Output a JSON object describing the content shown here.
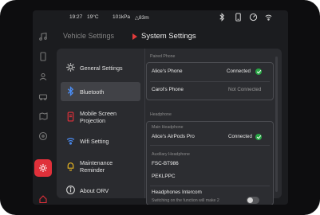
{
  "status": {
    "time": "19:27",
    "temp": "19°C",
    "pressure": "101kPa",
    "altitude": "△83m"
  },
  "status_icons": [
    "bluetooth-icon",
    "phone-icon",
    "speedometer-icon",
    "wifi-icon"
  ],
  "rail_icons": [
    "music-icon",
    "phone-icon",
    "profile-icon",
    "car-icon",
    "map-icon",
    "steering-icon",
    "settings-icon",
    "home-icon"
  ],
  "header": {
    "left": "Vehicle Settings",
    "right": "System Settings"
  },
  "menu": [
    {
      "label": "General Settings",
      "icon": "gear-icon"
    },
    {
      "label": "Bluetooth",
      "icon": "bluetooth-icon"
    },
    {
      "label_line1": "Mobile Screen",
      "label_line2": "Projection",
      "icon": "screen-projection-icon"
    },
    {
      "label": "Wifi Setting",
      "icon": "wifi-icon"
    },
    {
      "label_line1": "Maintenance",
      "label_line2": "Reminder",
      "icon": "bell-icon"
    },
    {
      "label": "About ORV",
      "icon": "info-icon"
    }
  ],
  "paired": {
    "title": "Paired Phone",
    "devices": [
      {
        "name": "Alice's Phone",
        "status": "Connected"
      },
      {
        "name": "Carol's Phone",
        "status": "Not Connected"
      }
    ]
  },
  "headphone": {
    "title": "Headphone",
    "main_label": "Main Headphone",
    "main": {
      "name": "Alice's AirPods Pro",
      "status": "Connected"
    },
    "aux_label": "Auxiliary Headphone",
    "aux": [
      "FSC-BT986",
      "PEKLPPC"
    ],
    "intercom_title": "Headphones Intercom",
    "intercom_desc": "Switching on the function will make 2",
    "intercom_on": false
  },
  "colors": {
    "accent": "#e0303a",
    "connected": "#29a745"
  }
}
